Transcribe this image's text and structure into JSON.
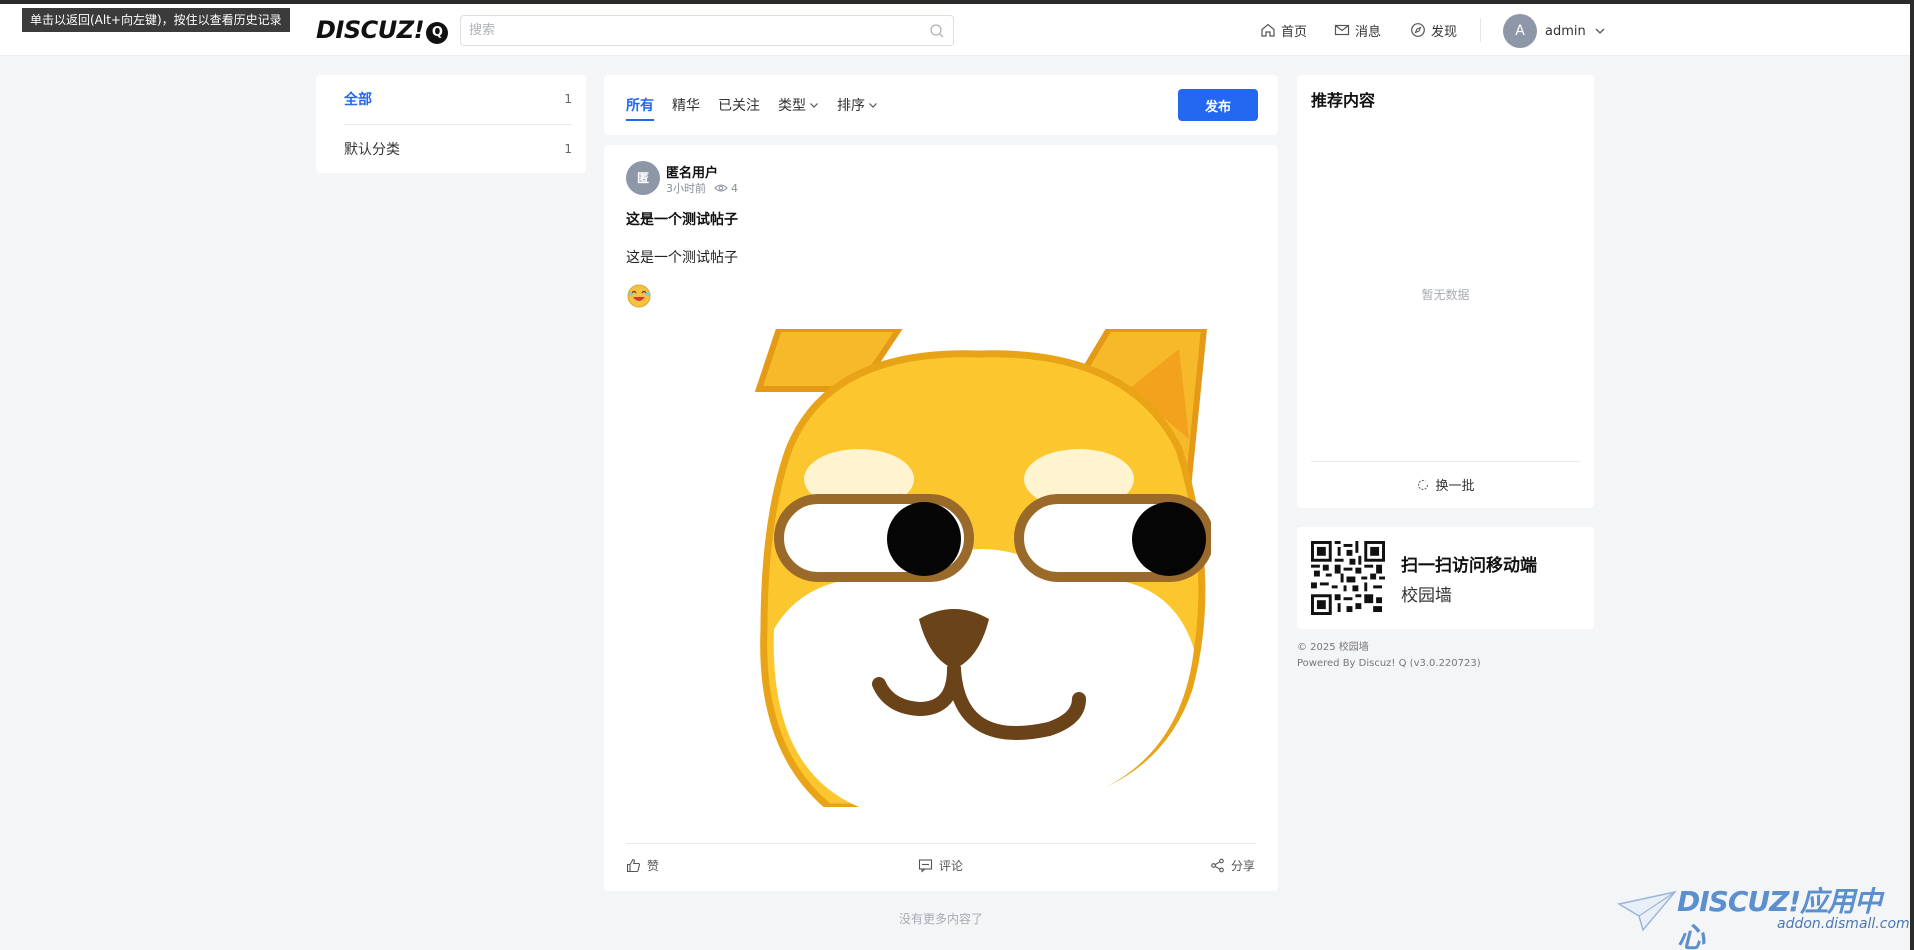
{
  "tooltip": "单击以返回(Alt+向左键)，按住以查看历史记录",
  "header": {
    "logo": "DISCUZ!",
    "logo_q": "Q",
    "search_placeholder": "搜索",
    "nav": [
      {
        "label": "首页",
        "icon": "home-icon"
      },
      {
        "label": "消息",
        "icon": "mail-icon"
      },
      {
        "label": "发现",
        "icon": "compass-icon"
      }
    ],
    "user": {
      "avatar_letter": "A",
      "name": "admin"
    }
  },
  "categories": [
    {
      "label": "全部",
      "count": "1",
      "active": true
    },
    {
      "label": "默认分类",
      "count": "1",
      "active": false
    }
  ],
  "tabs": {
    "items": [
      {
        "label": "所有",
        "active": true
      },
      {
        "label": "精华",
        "active": false
      },
      {
        "label": "已关注",
        "active": false
      },
      {
        "label": "类型",
        "active": false
      },
      {
        "label": "排序",
        "active": false
      }
    ],
    "publish_label": "发布"
  },
  "post": {
    "avatar_letter": "匿",
    "author": "匿名用户",
    "time": "3小时前",
    "views": "4",
    "title": "这是一个测试帖子",
    "body": "这是一个测试帖子",
    "actions": {
      "like": "赞",
      "comment": "评论",
      "share": "分享"
    }
  },
  "no_more": "没有更多内容了",
  "recommend": {
    "title": "推荐内容",
    "empty": "暂无数据",
    "refresh": "换一批"
  },
  "qr": {
    "title": "扫一扫访问移动端",
    "subtitle": "校园墙"
  },
  "footer": {
    "copyright": "© 2025 校园墙",
    "powered": "Powered By Discuz! Q (v3.0.220723)"
  },
  "watermark": {
    "logo": "DISCUZ!应用中心",
    "url": "addon.dismall.com"
  },
  "colors": {
    "accent": "#2468f2",
    "background": "#f4f5f7",
    "avatar": "#8d97a8"
  }
}
